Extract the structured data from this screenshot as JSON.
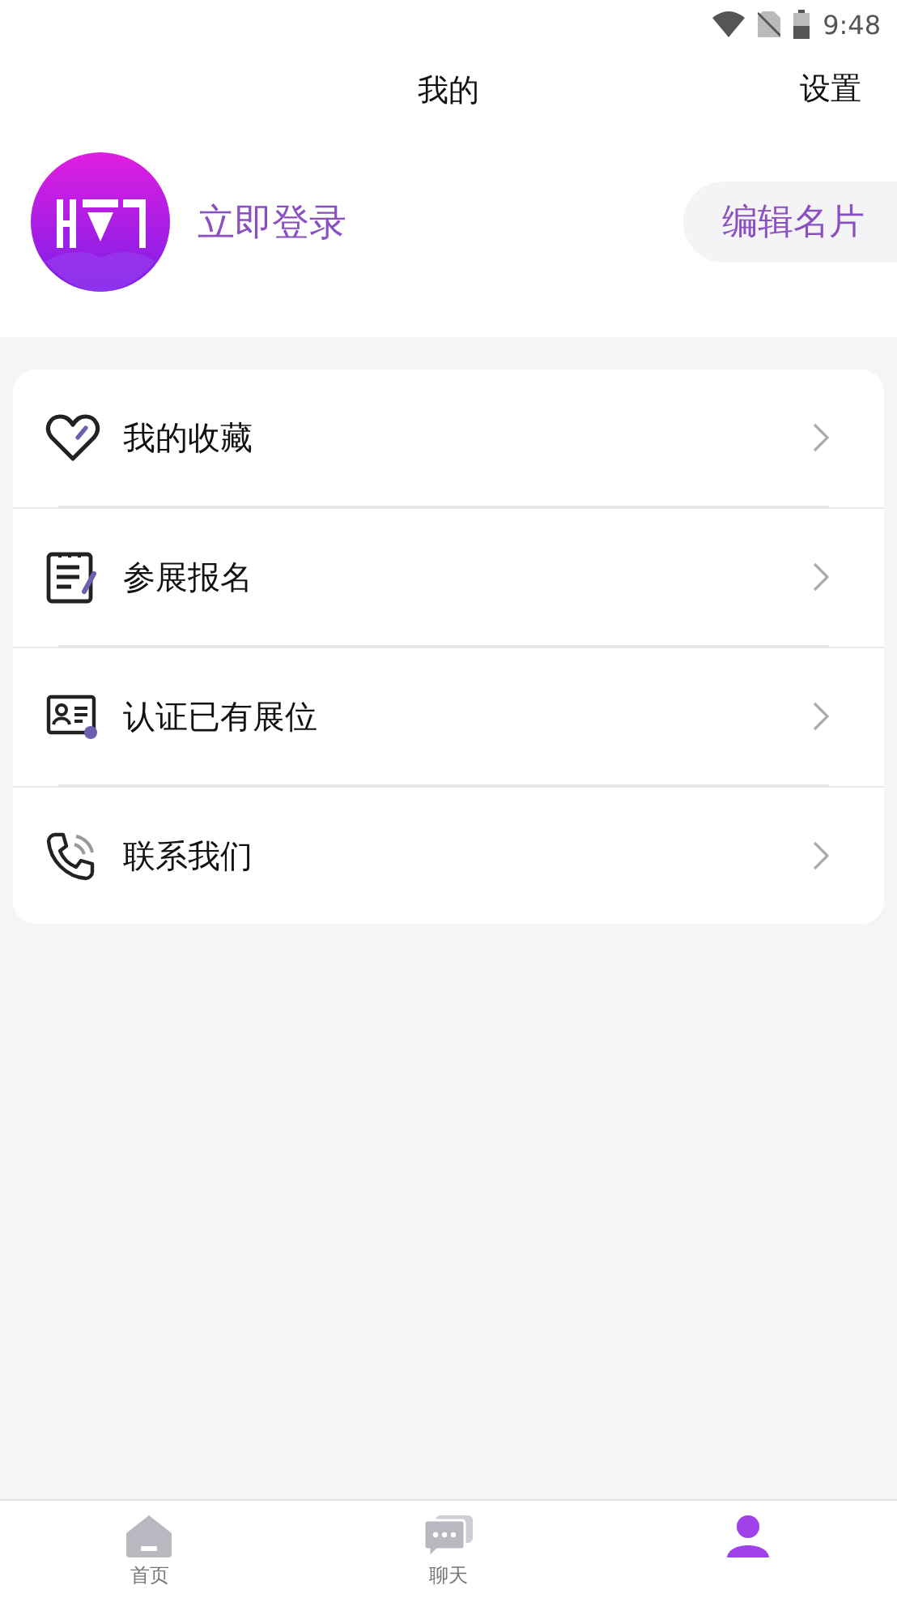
{
  "status_bar": {
    "time": "9:48"
  },
  "header": {
    "title": "我的",
    "action": "设置"
  },
  "profile": {
    "login": "立即登录",
    "button": "编辑名片"
  },
  "menu": [
    {
      "kind": "heart",
      "label": "我的收藏"
    },
    {
      "kind": "form",
      "label": "参展报名"
    },
    {
      "kind": "card",
      "label": "认证已有展位"
    },
    {
      "kind": "phone",
      "label": "联系我们"
    }
  ],
  "tabs": [
    {
      "kind": "home",
      "label": "首页",
      "selected": false
    },
    {
      "kind": "chat",
      "label": "聊天",
      "selected": false
    },
    {
      "kind": "profile",
      "selected": true
    }
  ]
}
